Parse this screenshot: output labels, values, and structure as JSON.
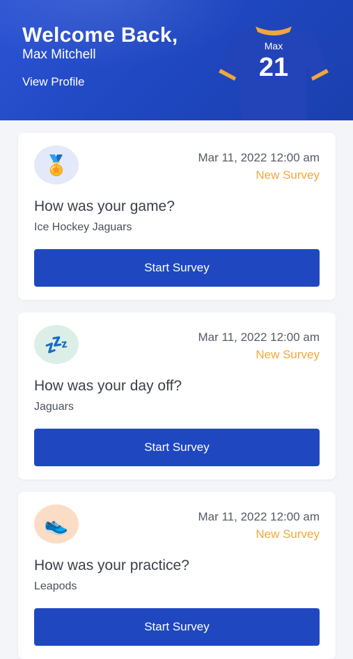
{
  "header": {
    "welcome": "Welcome Back,",
    "name": "Max Mitchell",
    "view_profile": "View Profile",
    "jersey_name": "Max",
    "jersey_number": "21"
  },
  "surveys": [
    {
      "icon": "medal-icon",
      "icon_glyph": "🏅",
      "icon_bg": "#e3e9f8",
      "date": "Mar 11, 2022 12:00 am",
      "status": "New Survey",
      "title": "How was your game?",
      "team": "Ice Hockey Jaguars",
      "button": "Start Survey"
    },
    {
      "icon": "sleep-zzz-icon",
      "icon_glyph": "💤",
      "icon_bg": "#dcefe6",
      "date": "Mar 11, 2022 12:00 am",
      "status": "New Survey",
      "title": "How was your day off?",
      "team": "Jaguars",
      "button": "Start Survey"
    },
    {
      "icon": "sneaker-icon",
      "icon_glyph": "👟",
      "icon_bg": "#fbdcc4",
      "date": "Mar 11, 2022 12:00 am",
      "status": "New Survey",
      "title": "How was your practice?",
      "team": "Leapods",
      "button": "Start Survey"
    }
  ],
  "colors": {
    "brand_blue": "#1f48c0",
    "status_orange": "#f0a83a",
    "jersey_trim": "#f0a83a"
  }
}
